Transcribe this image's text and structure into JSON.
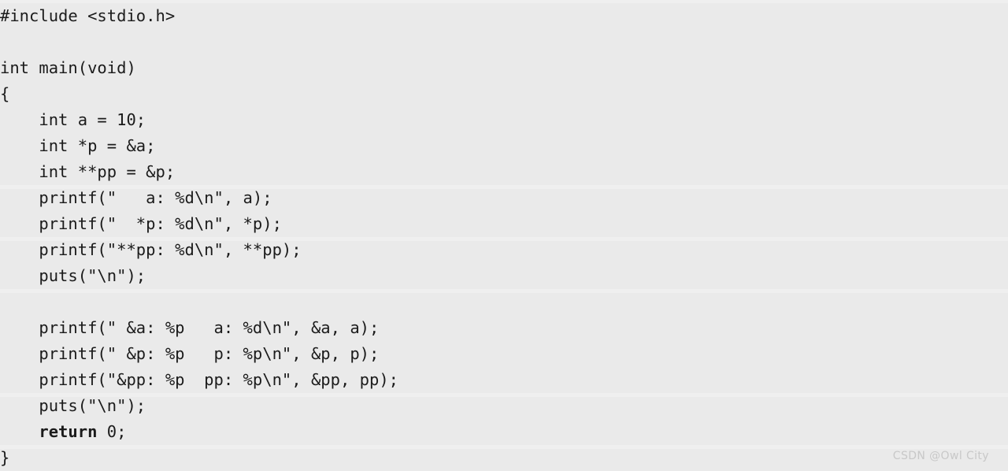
{
  "document": {
    "type": "code-snippet",
    "language": "c",
    "background_color": "#eaeaea",
    "stripe_color": "#efefef",
    "text_color": "#1b1b1b",
    "lines": [
      {
        "indent": 0,
        "text": "#include <stdio.h>"
      },
      {
        "indent": 0,
        "text": ""
      },
      {
        "indent": 0,
        "text": "int main(void)"
      },
      {
        "indent": 0,
        "text": "{"
      },
      {
        "indent": 0,
        "text": "    int a = 10;"
      },
      {
        "indent": 0,
        "text": "    int *p = &a;"
      },
      {
        "indent": 0,
        "text": "    int **pp = &p;"
      },
      {
        "indent": 0,
        "text": "    printf(\"   a: %d\\n\", a);"
      },
      {
        "indent": 0,
        "text": "    printf(\"  *p: %d\\n\", *p);"
      },
      {
        "indent": 0,
        "text": "    printf(\"**pp: %d\\n\", **pp);"
      },
      {
        "indent": 0,
        "text": "    puts(\"\\n\");"
      },
      {
        "indent": 0,
        "text": ""
      },
      {
        "indent": 0,
        "text": "    printf(\" &a: %p   a: %d\\n\", &a, a);"
      },
      {
        "indent": 0,
        "text": "    printf(\" &p: %p   p: %p\\n\", &p, p);"
      },
      {
        "indent": 0,
        "text": "    printf(\"&pp: %p  pp: %p\\n\", &pp, pp);"
      },
      {
        "indent": 0,
        "text": "    puts(\"\\n\");"
      },
      {
        "indent": 0,
        "text": "    return 0;",
        "bold_prefix": "    return",
        "rest": " 0;"
      },
      {
        "indent": 0,
        "text": "}"
      }
    ]
  },
  "watermark": {
    "text": "CSDN @Owl City"
  }
}
